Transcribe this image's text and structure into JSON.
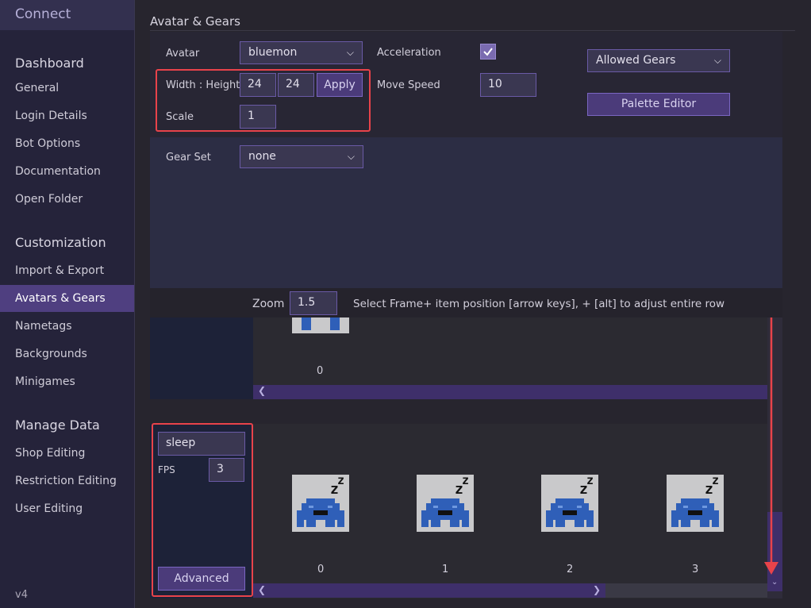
{
  "sidebar": {
    "brand": "Connect",
    "sections": [
      {
        "title": "Dashboard",
        "items": [
          "General",
          "Login Details",
          "Bot Options",
          "Documentation",
          "Open Folder"
        ]
      },
      {
        "title": "Customization",
        "items": [
          "Import & Export",
          "Avatars & Gears",
          "Nametags",
          "Backgrounds",
          "Minigames"
        ]
      },
      {
        "title": "Manage Data",
        "items": [
          "Shop Editing",
          "Restriction Editing",
          "User Editing"
        ]
      }
    ],
    "active": "Avatars & Gears",
    "version": "v4"
  },
  "page": {
    "title": "Avatar & Gears"
  },
  "avatar": {
    "label": "Avatar",
    "value": "bluemon",
    "size_label": "Width : Height",
    "width": "24",
    "height": "24",
    "apply": "Apply",
    "scale_label": "Scale",
    "scale": "1"
  },
  "movement": {
    "accel_label": "Acceleration",
    "accel_checked": true,
    "speed_label": "Move Speed",
    "speed": "10"
  },
  "gears": {
    "allowed": "Allowed Gears",
    "palette": "Palette Editor",
    "gearset_label": "Gear Set",
    "gearset": "none"
  },
  "zoom": {
    "label": "Zoom",
    "value": "1.5",
    "hint": "Select Frame+ item position [arrow keys], + [alt] to adjust entire row"
  },
  "row1": {
    "frames": [
      "0"
    ]
  },
  "row2": {
    "name": "sleep",
    "fps_label": "FPS",
    "fps": "3",
    "advanced": "Advanced",
    "frames": [
      "0",
      "1",
      "2",
      "3"
    ]
  },
  "colors": {
    "accent": "#4f3f80",
    "highlight": "#e8434a",
    "sprite": "#2f5fb8"
  }
}
